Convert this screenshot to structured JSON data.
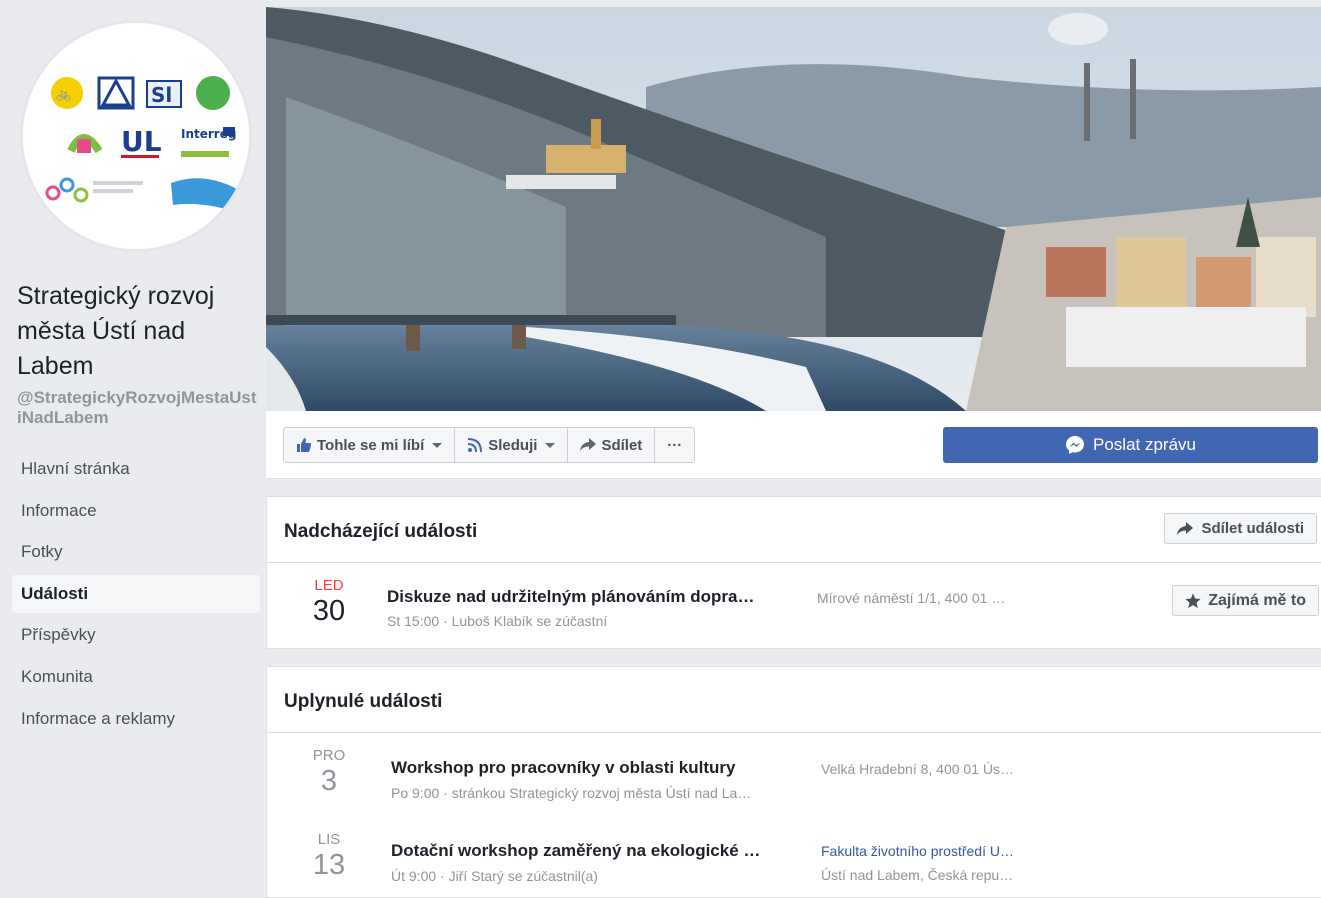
{
  "page": {
    "name": "Strategický rozvoj města Ústí nad Labem",
    "handle": "@StrategickyRozvojMestaUstiNadLabem"
  },
  "nav": [
    {
      "label": "Hlavní stránka",
      "active": false
    },
    {
      "label": "Informace",
      "active": false
    },
    {
      "label": "Fotky",
      "active": false
    },
    {
      "label": "Události",
      "active": true
    },
    {
      "label": "Příspěvky",
      "active": false
    },
    {
      "label": "Komunita",
      "active": false
    },
    {
      "label": "Informace a reklamy",
      "active": false
    }
  ],
  "actions": {
    "like": "Tohle se mi líbí",
    "follow": "Sleduji",
    "share": "Sdílet",
    "more": "···",
    "send_message": "Poslat zprávu"
  },
  "upcoming": {
    "title": "Nadcházející události",
    "share_button": "Sdílet události",
    "events": [
      {
        "month": "LED",
        "day": "30",
        "title": "Diskuze nad udržitelným plánováním dopra…",
        "subtitle": "St 15:00 · Luboš Klabík se zúčastní",
        "location": "Mírové náměstí 1/1, 400 01 …",
        "interested_label": "Zajímá mě to"
      }
    ]
  },
  "past": {
    "title": "Uplynulé události",
    "events": [
      {
        "month": "PRO",
        "day": "3",
        "title": "Workshop pro pracovníky v oblasti kultury",
        "subtitle": "Po 9:00 · stránkou Strategický rozvoj města Ústí nad La…",
        "location": "Velká Hradební 8, 400 01 Ús…",
        "location2": ""
      },
      {
        "month": "LIS",
        "day": "13",
        "title": "Dotační workshop zaměřený na ekologické …",
        "subtitle": "Út 9:00 · Jiří Starý se zúčastnil(a)",
        "location": "Fakulta životního prostředí U…",
        "location2": "Ústí nad Labem, Česká repu…"
      }
    ]
  },
  "colors": {
    "brand_blue": "#4267b2",
    "link_blue": "#365899",
    "date_red": "#fa3e3e",
    "background": "#e9ebee"
  }
}
